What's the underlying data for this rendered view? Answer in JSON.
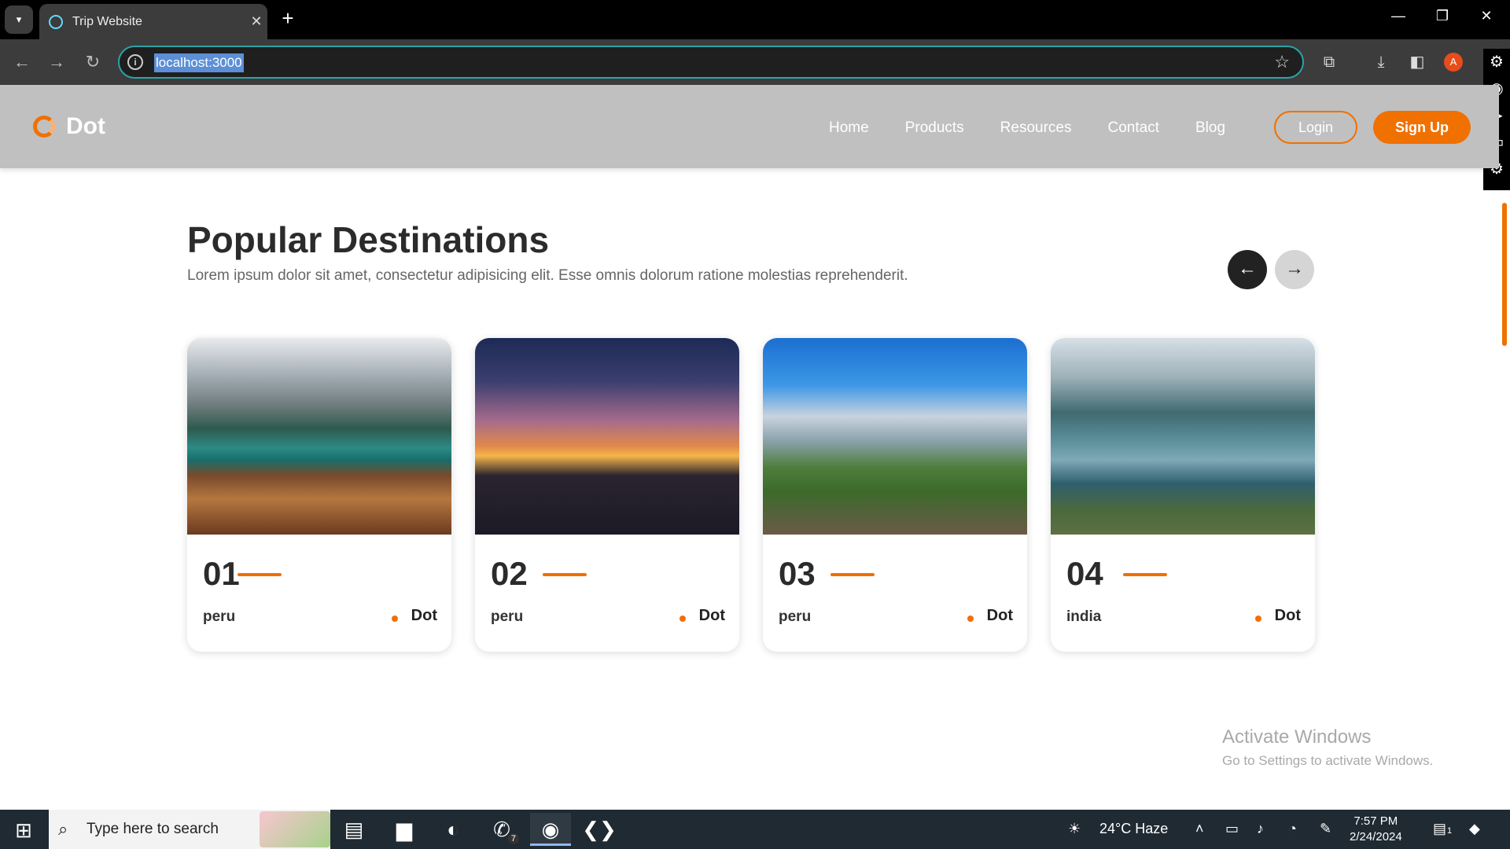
{
  "browser": {
    "tab_title": "Trip Website",
    "url": "localhost:3000",
    "avatar_letter": "A"
  },
  "site": {
    "logo_text": "Dot",
    "nav": [
      "Home",
      "Products",
      "Resources",
      "Contact",
      "Blog"
    ],
    "login_label": "Login",
    "signup_label": "Sign Up",
    "accent_color": "#f07000"
  },
  "section": {
    "title": "Popular Destinations",
    "description": "Lorem ipsum dolor sit amet, consectetur adipisicing elit. Esse omnis dolorum ratione molestias reprehenderit."
  },
  "cards": [
    {
      "number": "01",
      "place": "peru",
      "brand": "Dot"
    },
    {
      "number": "02",
      "place": "peru",
      "brand": "Dot"
    },
    {
      "number": "03",
      "place": "peru",
      "brand": "Dot"
    },
    {
      "number": "04",
      "place": "india",
      "brand": "Dot"
    }
  ],
  "watermark": {
    "line1": "Activate Windows",
    "line2": "Go to Settings to activate Windows."
  },
  "taskbar": {
    "search_placeholder": "Type here to search",
    "whatsapp_badge": "7",
    "weather": "24°C  Haze",
    "time": "7:57 PM",
    "date": "2/24/2024",
    "notification_count": "1"
  }
}
